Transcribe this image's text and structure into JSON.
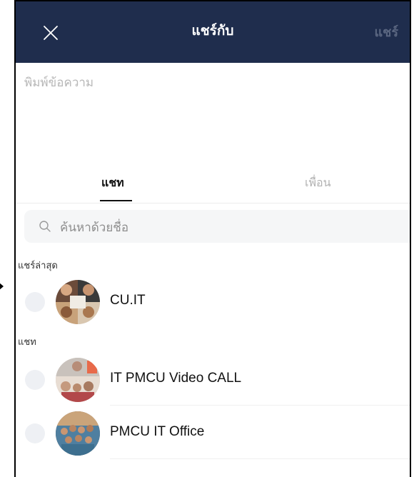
{
  "header": {
    "title": "แชร์กับ",
    "share_label": "แชร์",
    "background_color": "#1f2d4d"
  },
  "message": {
    "placeholder": "พิมพ์ข้อความ"
  },
  "tabs": [
    {
      "label": "แชท",
      "active": true
    },
    {
      "label": "เพื่อน",
      "active": false
    }
  ],
  "search": {
    "placeholder": "ค้นหาด้วยชื่อ"
  },
  "sections": {
    "recent_label": "แชร์ล่าสุด",
    "chat_label": "แชท"
  },
  "recent": [
    {
      "name": "CU.IT",
      "avatar": "group-photo-avatar"
    }
  ],
  "chats": [
    {
      "name": "IT PMCU Video CALL",
      "avatar": "video-call-photo-avatar"
    },
    {
      "name": "PMCU IT Office",
      "avatar": "team-photo-avatar"
    }
  ],
  "icons": {
    "close": "close-icon",
    "search": "search-icon"
  }
}
